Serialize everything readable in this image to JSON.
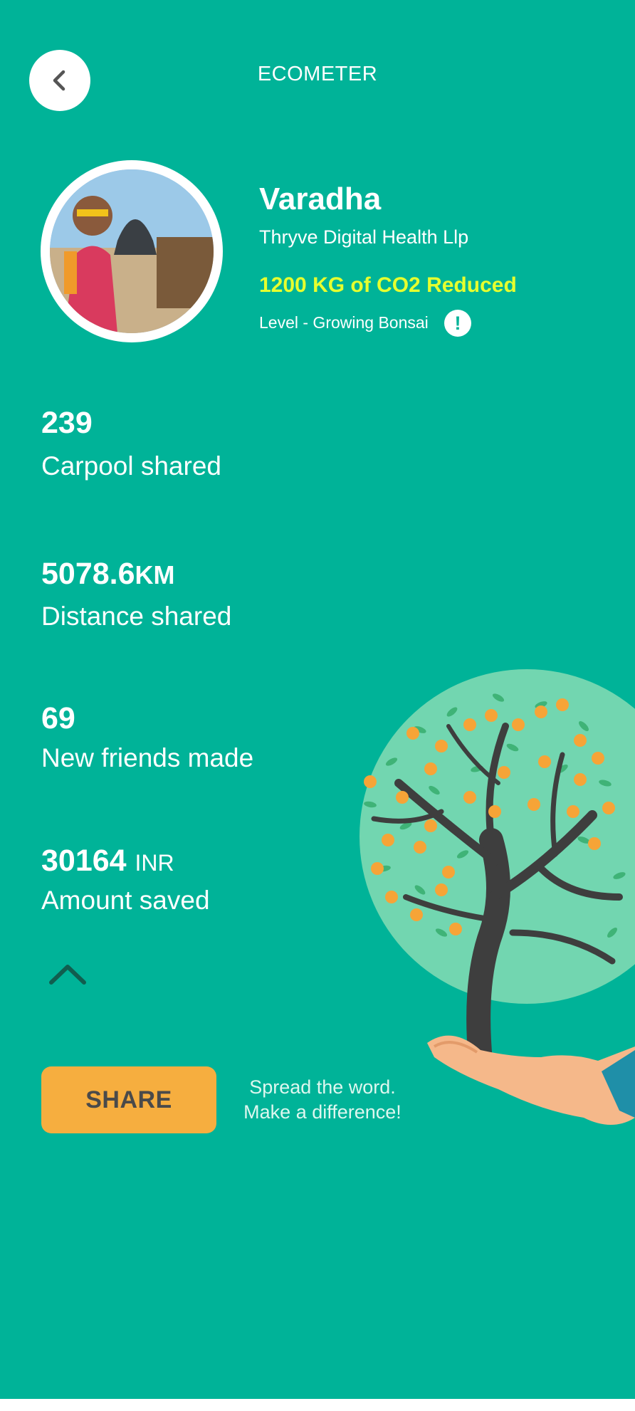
{
  "header": {
    "title": "ECOMETER"
  },
  "profile": {
    "name": "Varadha",
    "company": "Thryve Digital Health Llp",
    "co2": "1200 KG of CO2 Reduced",
    "level": "Level - Growing Bonsai",
    "info_glyph": "!"
  },
  "stats": [
    {
      "value": "239",
      "unit": "",
      "label": "Carpool shared"
    },
    {
      "value": "5078.6",
      "unit": "KM",
      "label": "Distance shared"
    },
    {
      "value": "69",
      "unit": "",
      "label": "New friends made"
    },
    {
      "value": "30164",
      "unit": "INR",
      "label": "Amount saved"
    }
  ],
  "share": {
    "button_label": "SHARE",
    "tagline_line1": "Spread the word.",
    "tagline_line2": "Make a difference!"
  },
  "icons": {
    "back": "chevron-left-icon",
    "info": "info-icon",
    "collapse": "chevron-up-icon"
  },
  "colors": {
    "background": "#00B398",
    "co2_highlight": "#E6FF2E",
    "share_button": "#F6AE3F"
  }
}
